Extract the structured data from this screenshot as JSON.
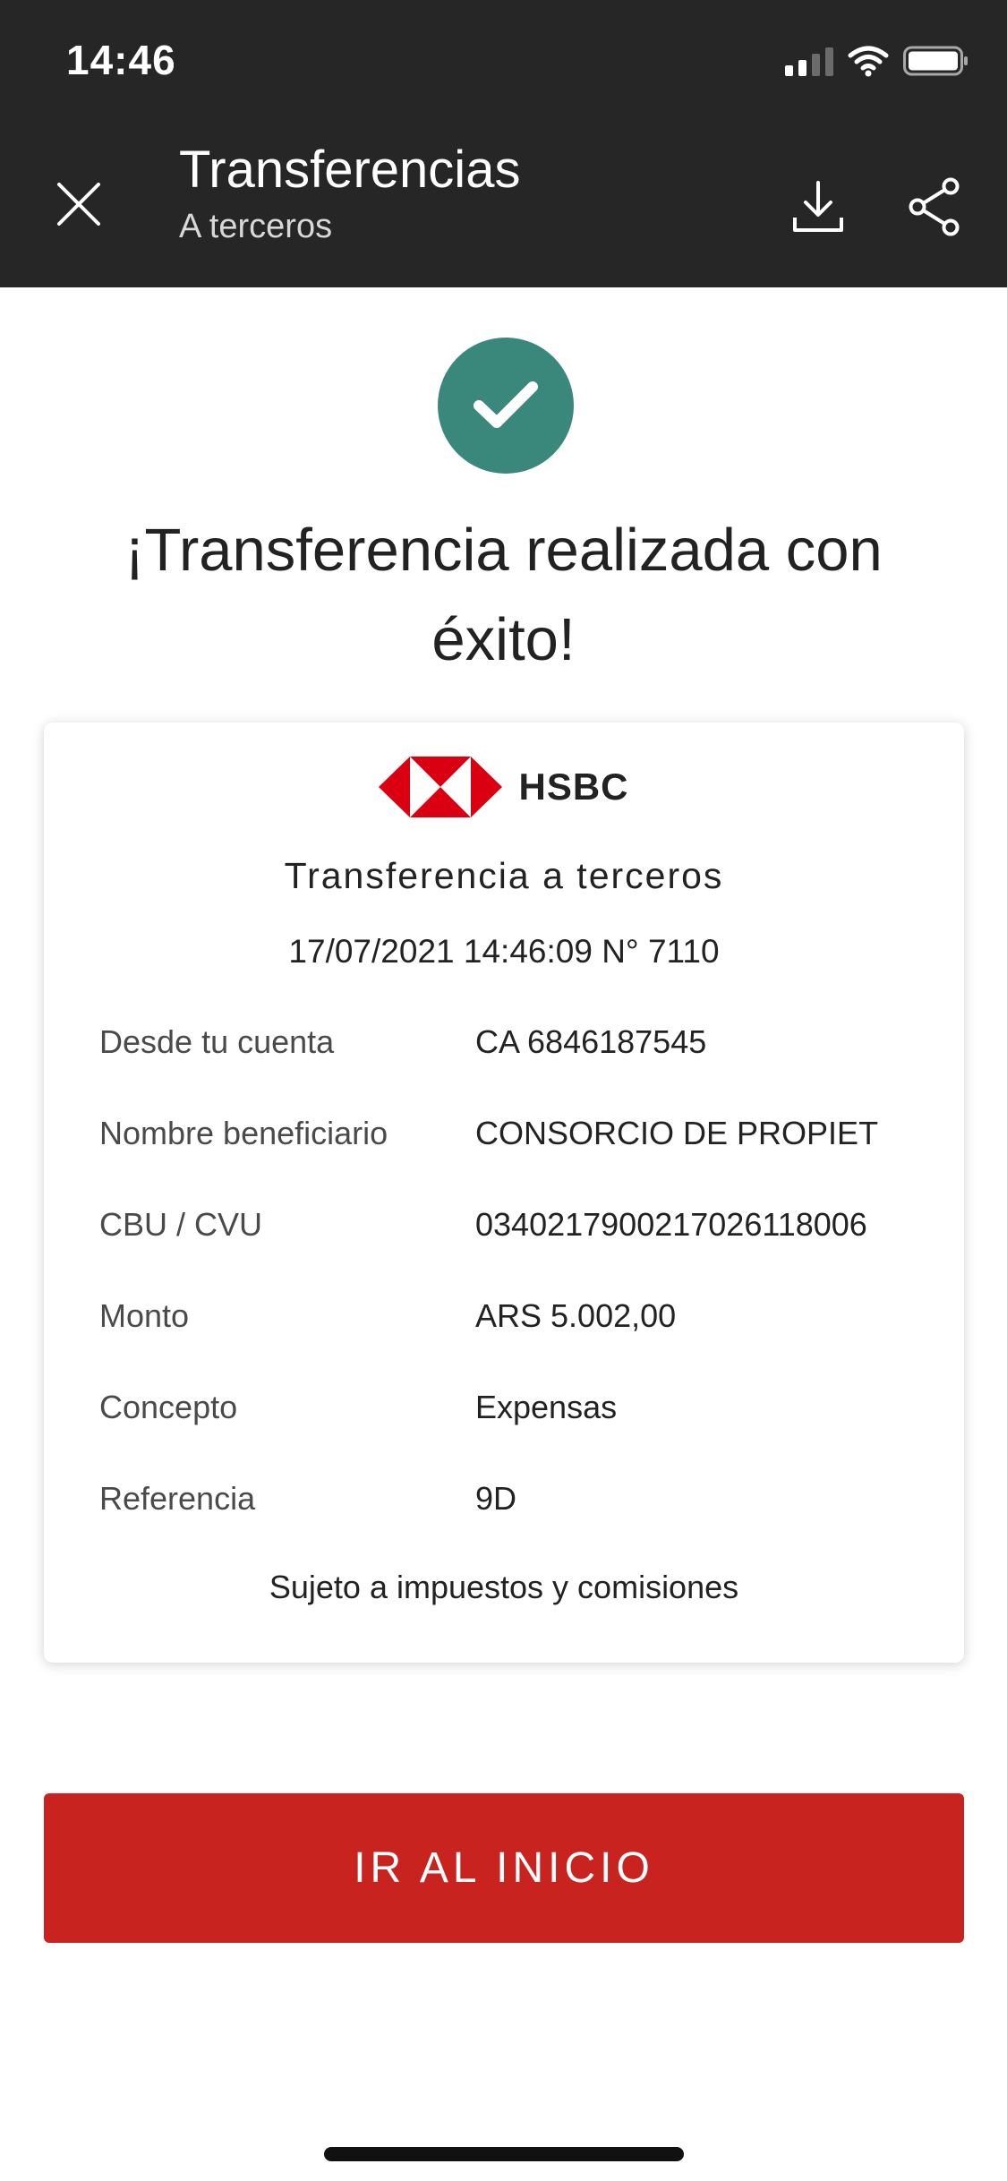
{
  "status_bar": {
    "time": "14:46"
  },
  "header": {
    "title": "Transferencias",
    "subtitle": "A terceros"
  },
  "success": {
    "message": "¡Transferencia realizada con éxito!"
  },
  "receipt": {
    "brand": "HSBC",
    "title": "Transferencia a terceros",
    "datetime": "17/07/2021 14:46:09 N° 7110",
    "rows": [
      {
        "label": "Desde tu cuenta",
        "value": "CA 6846187545"
      },
      {
        "label": "Nombre beneficiario",
        "value": "CONSORCIO DE PROPIET"
      },
      {
        "label": "CBU / CVU",
        "value": "0340217900217026118006"
      },
      {
        "label": "Monto",
        "value": "ARS 5.002,00"
      },
      {
        "label": "Concepto",
        "value": "Expensas"
      },
      {
        "label": "Referencia",
        "value": "9D"
      }
    ],
    "disclaimer": "Sujeto a impuestos y comisiones"
  },
  "actions": {
    "home_label": "IR AL INICIO"
  },
  "colors": {
    "header_bg": "#262626",
    "success": "#3a877c",
    "brand_red": "#c8231f"
  },
  "icons": [
    "close-icon",
    "download-icon",
    "share-icon",
    "check-icon",
    "hsbc-logo",
    "signal-icon",
    "wifi-icon",
    "battery-icon"
  ]
}
